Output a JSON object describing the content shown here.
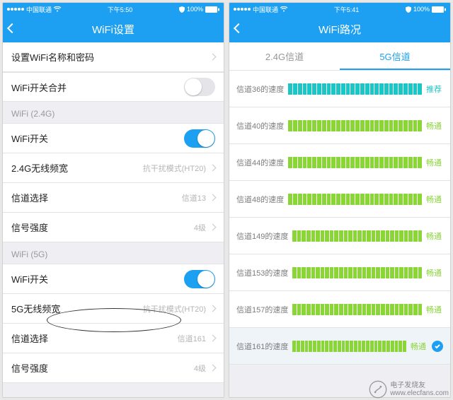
{
  "left": {
    "status": {
      "carrier": "中国联通",
      "time": "下午5:50",
      "battery": "100%"
    },
    "title": "WiFi设置",
    "cells": [
      {
        "label": "设置WiFi名称和密码",
        "sub": ""
      },
      {
        "label": "WiFi开关合并",
        "switch": false
      }
    ],
    "sec24": "WiFi (2.4G)",
    "g24": [
      {
        "label": "WiFi开关",
        "switch": true
      },
      {
        "label": "2.4G无线频宽",
        "sub": "抗干扰模式(HT20)"
      },
      {
        "label": "信道选择",
        "sub": "信道13"
      },
      {
        "label": "信号强度",
        "sub": "4级"
      }
    ],
    "sec5": "WiFi (5G)",
    "g5": [
      {
        "label": "WiFi开关",
        "switch": true
      },
      {
        "label": "5G无线频宽",
        "sub": "抗干扰模式(HT20)"
      },
      {
        "label": "信道选择",
        "sub": "信道161"
      },
      {
        "label": "信号强度",
        "sub": "4级"
      }
    ]
  },
  "right": {
    "status": {
      "carrier": "中国联通",
      "time": "下午5:41",
      "battery": "100%"
    },
    "title": "WiFi路况",
    "tabs": {
      "a": "2.4G信道",
      "b": "5G信道"
    },
    "channels": [
      {
        "label": "信道36的速度",
        "status": "推荐",
        "type": "rec",
        "selected": false
      },
      {
        "label": "信道40的速度",
        "status": "畅通",
        "type": "ok",
        "selected": false
      },
      {
        "label": "信道44的速度",
        "status": "畅通",
        "type": "ok",
        "selected": false
      },
      {
        "label": "信道48的速度",
        "status": "畅通",
        "type": "ok",
        "selected": false
      },
      {
        "label": "信道149的速度",
        "status": "畅通",
        "type": "ok",
        "selected": false
      },
      {
        "label": "信道153的速度",
        "status": "畅通",
        "type": "ok",
        "selected": false
      },
      {
        "label": "信道157的速度",
        "status": "畅通",
        "type": "ok",
        "selected": false
      },
      {
        "label": "信道161的速度",
        "status": "畅通",
        "type": "ok",
        "selected": true
      }
    ]
  },
  "watermark": "电子发烧友\nwww.elecfans.com"
}
